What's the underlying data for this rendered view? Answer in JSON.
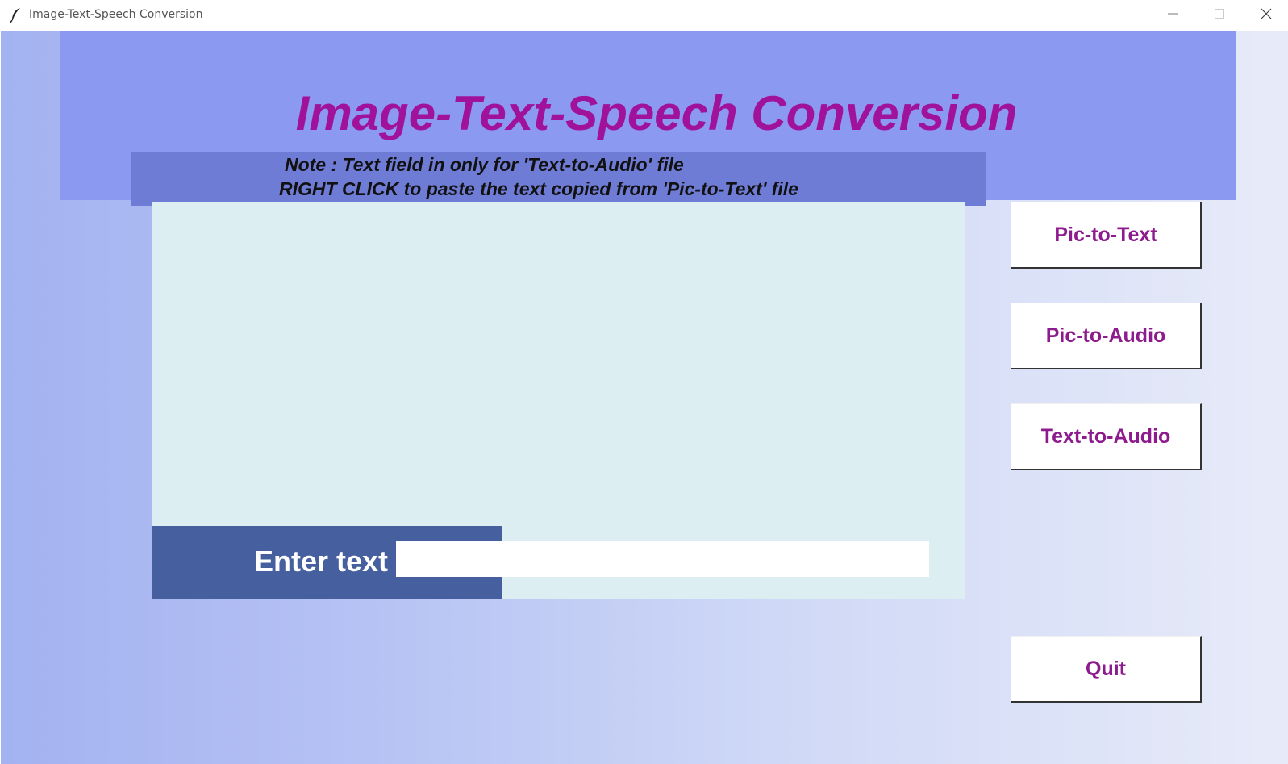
{
  "window": {
    "title": "Image-Text-Speech Conversion",
    "controls": [
      "minimize",
      "maximize",
      "close"
    ]
  },
  "header": {
    "title": "Image-Text-Speech Conversion",
    "note_line1": "Note : Text field in only for 'Text-to-Audio' file",
    "note_line2": "RIGHT CLICK to paste the text copied from 'Pic-to-Text' file"
  },
  "entry": {
    "label": "Enter text :",
    "value": ""
  },
  "buttons": {
    "pic_to_text": "Pic-to-Text",
    "pic_to_audio": "Pic-to-Audio",
    "text_to_audio": "Text-to-Audio",
    "quit": "Quit"
  },
  "colors": {
    "title": "#a1129b",
    "header_band": "#8c99f1",
    "note_band": "#6f7cd6",
    "text_area": "#dceef1",
    "entry_label_bg": "#455f9f",
    "button_text": "#8e1b8e"
  },
  "icons": {
    "app": "feather-icon",
    "minimize": "minimize-icon",
    "maximize": "maximize-icon",
    "close": "close-icon"
  }
}
